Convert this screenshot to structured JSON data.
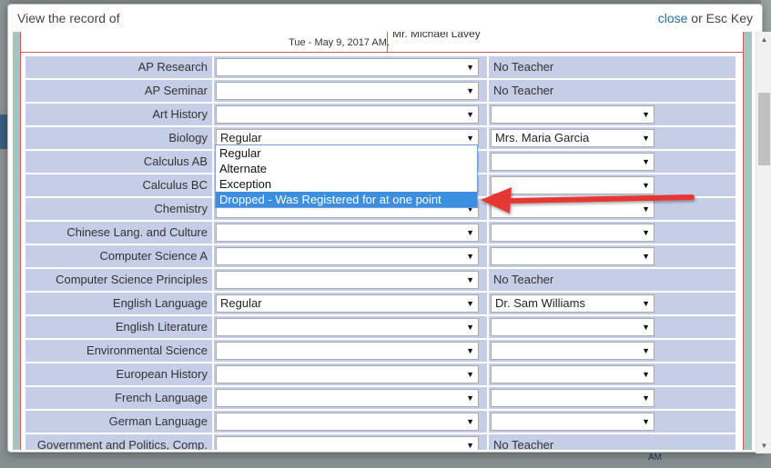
{
  "modal": {
    "title": "View the record of",
    "close_label": "close",
    "close_suffix": " or Esc Key"
  },
  "info": {
    "date": "Tue - May 9, 2017 AM.",
    "teacher": "Mr. Michael Lavey"
  },
  "no_teacher_text": "No Teacher",
  "courses": [
    {
      "name": "AP Research",
      "status": "",
      "teacher": "No Teacher",
      "has_teacher_select": false
    },
    {
      "name": "AP Seminar",
      "status": "",
      "teacher": "No Teacher",
      "has_teacher_select": false
    },
    {
      "name": "Art History",
      "status": "",
      "teacher": "",
      "has_teacher_select": true
    },
    {
      "name": "Biology",
      "status": "Regular",
      "teacher": "Mrs. Maria Garcia",
      "has_teacher_select": true
    },
    {
      "name": "Calculus AB",
      "status": "",
      "teacher": "",
      "has_teacher_select": true
    },
    {
      "name": "Calculus BC",
      "status": "",
      "teacher": "",
      "has_teacher_select": true
    },
    {
      "name": "Chemistry",
      "status": "",
      "teacher": "",
      "has_teacher_select": true
    },
    {
      "name": "Chinese Lang. and Culture",
      "status": "",
      "teacher": "",
      "has_teacher_select": true
    },
    {
      "name": "Computer Science A",
      "status": "",
      "teacher": "",
      "has_teacher_select": true
    },
    {
      "name": "Computer Science Principles",
      "status": "",
      "teacher": "No Teacher",
      "has_teacher_select": false
    },
    {
      "name": "English Language",
      "status": "Regular",
      "teacher": "Dr. Sam Williams",
      "has_teacher_select": true
    },
    {
      "name": "English Literature",
      "status": "",
      "teacher": "",
      "has_teacher_select": true
    },
    {
      "name": "Environmental Science",
      "status": "",
      "teacher": "",
      "has_teacher_select": true
    },
    {
      "name": "European History",
      "status": "",
      "teacher": "",
      "has_teacher_select": true
    },
    {
      "name": "French Language",
      "status": "",
      "teacher": "",
      "has_teacher_select": true
    },
    {
      "name": "German Language",
      "status": "",
      "teacher": "",
      "has_teacher_select": true
    },
    {
      "name": "Government and Politics, Comp.",
      "status": "",
      "teacher": "No Teacher",
      "has_teacher_select": false
    }
  ],
  "dropdown": {
    "options": [
      "Regular",
      "Alternate",
      "Exception",
      "Dropped - Was Registered for at one point"
    ],
    "highlighted_index": 3
  },
  "background": {
    "footer_text": "AM"
  },
  "colors": {
    "row_bg": "#c6cde6",
    "highlight": "#3b8fe0",
    "annotation_arrow": "#e53935",
    "link": "#2a6aa8"
  }
}
